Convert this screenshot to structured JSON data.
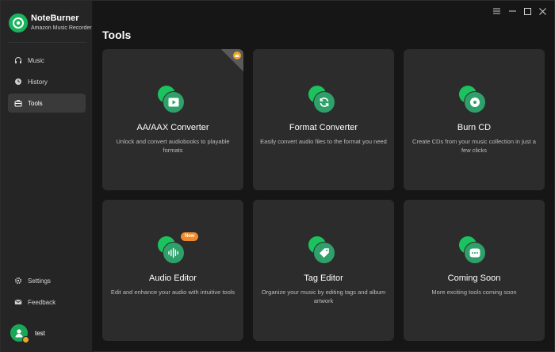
{
  "app": {
    "name": "NoteBurner",
    "subtitle": "Amazon Music Recorder"
  },
  "sidebar": {
    "items": [
      {
        "label": "Music",
        "icon": "headphones-icon"
      },
      {
        "label": "History",
        "icon": "clock-icon"
      },
      {
        "label": "Tools",
        "icon": "toolbox-icon",
        "active": true
      }
    ],
    "bottom_items": [
      {
        "label": "Settings",
        "icon": "gear-icon"
      },
      {
        "label": "Feedback",
        "icon": "mail-icon"
      }
    ],
    "user": {
      "name": "test"
    }
  },
  "window_controls": [
    "menu-icon",
    "minimize-icon",
    "maximize-icon",
    "close-icon"
  ],
  "main": {
    "title": "Tools",
    "cards": [
      {
        "title": "AA/AAX Converter",
        "desc": "Unlock and convert audiobooks to playable formats",
        "icon": "play-icon",
        "premium": true
      },
      {
        "title": "Format Converter",
        "desc": "Easily convert audio files to the format you need",
        "icon": "refresh-icon"
      },
      {
        "title": "Burn CD",
        "desc": "Create CDs from your music collection in just a few clicks",
        "icon": "disc-icon"
      },
      {
        "title": "Audio Editor",
        "desc": "Edit and enhance your audio with intuitive tools",
        "icon": "waveform-icon",
        "badge": "New"
      },
      {
        "title": "Tag Editor",
        "desc": "Organize your music by editing tags and album artwork",
        "icon": "tag-icon"
      },
      {
        "title": "Coming Soon",
        "desc": "More exciting tools coming soon",
        "icon": "more-icon"
      }
    ]
  },
  "colors": {
    "accent": "#1cc25e",
    "sidebar_bg": "#252525",
    "card_bg": "#2c2c2c",
    "badge": "#f08a2a"
  }
}
